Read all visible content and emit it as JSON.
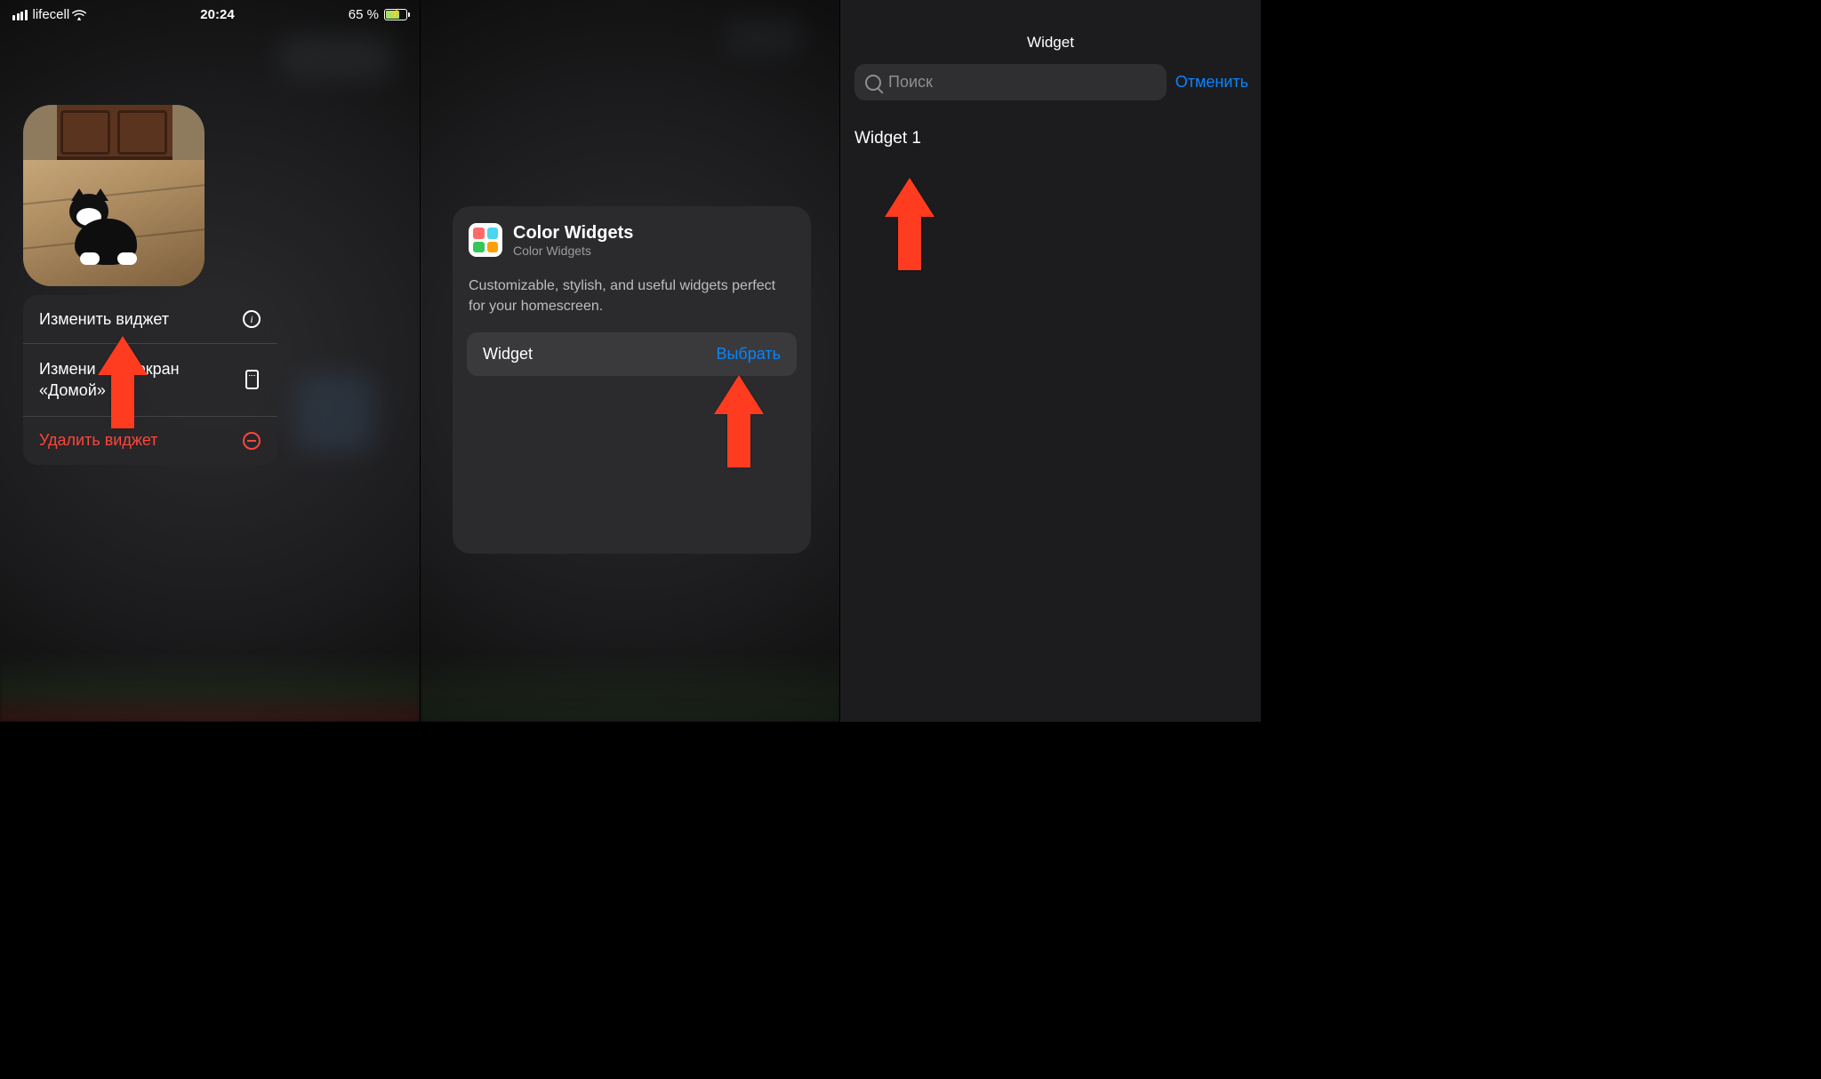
{
  "panel1": {
    "status": {
      "carrier": "lifecell",
      "time": "20:24",
      "battery_text": "65 %"
    },
    "context_menu": {
      "edit_widget": "Изменить виджет",
      "edit_home_part1": "Измени",
      "edit_home_part2": "экран",
      "edit_home_line2": "«Домой»",
      "delete_widget": "Удалить виджет"
    }
  },
  "panel2": {
    "app_title": "Color Widgets",
    "app_subtitle": "Color Widgets",
    "description": "Customizable, stylish, and useful widgets perfect for your homescreen.",
    "row_label": "Widget",
    "row_action": "Выбрать"
  },
  "panel3": {
    "header": "Widget",
    "search_placeholder": "Поиск",
    "cancel": "Отменить",
    "item1": "Widget 1"
  }
}
